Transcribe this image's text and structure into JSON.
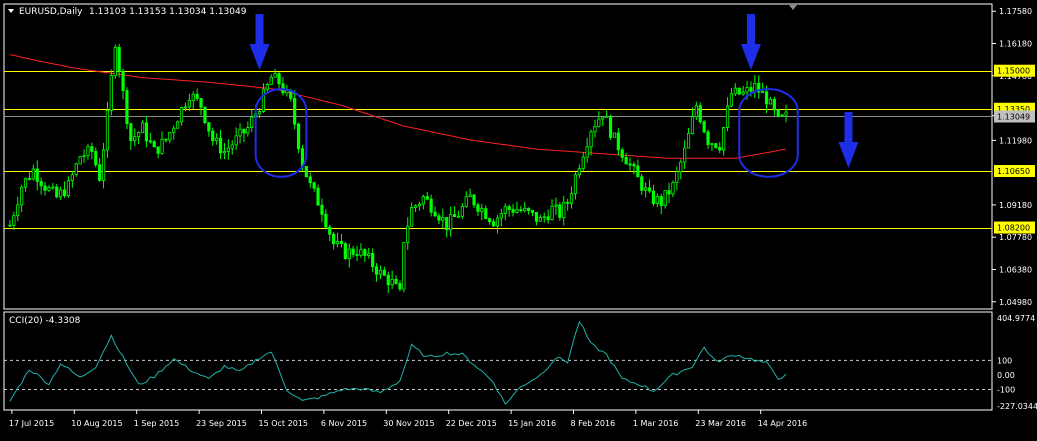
{
  "header": {
    "symbol_text": "EURUSD,Daily",
    "ohlc_text": "1.13103 1.13153 1.13034 1.13049"
  },
  "indicator": {
    "label": "CCI(20) -4.3308"
  },
  "colors": {
    "background": "#000000",
    "frame": "#ffffff",
    "bull_candle": "#00ff00",
    "bear_candle": "#00ff00",
    "moving_average": "#ff2020",
    "level_line": "#ffff00",
    "current_price_line": "#8c8c8c",
    "cci_line": "#20b2aa",
    "annotation": "#1e2ee8",
    "price_label_bg": "#ffff00",
    "current_label_bg": "#c0c0c0"
  },
  "chart_data": [
    {
      "type": "candlestick",
      "symbol": "EURUSD",
      "timeframe": "Daily",
      "x_tick_labels": [
        "17 Jul 2015",
        "10 Aug 2015",
        "1 Sep 2015",
        "23 Sep 2015",
        "15 Oct 2015",
        "6 Nov 2015",
        "30 Nov 2015",
        "22 Dec 2015",
        "15 Jan 2016",
        "8 Feb 2016",
        "1 Mar 2016",
        "23 Mar 2016",
        "14 Apr 2016"
      ],
      "y_tick_labels": [
        "1.17580",
        "1.16180",
        "1.14780",
        "1.13049",
        "1.11980",
        "1.09180",
        "1.07780",
        "1.06380",
        "1.04980"
      ],
      "ylim": [
        1.0484,
        1.1772
      ],
      "price_levels": [
        {
          "value": 1.15,
          "label": "1.15000"
        },
        {
          "value": 1.1335,
          "label": "1.13350"
        },
        {
          "value": 1.1065,
          "label": "1.10650"
        },
        {
          "value": 1.082,
          "label": "1.08200"
        }
      ],
      "current_price": {
        "value": 1.13049,
        "label": "1.13049"
      },
      "close_path": [
        [
          0,
          1.083
        ],
        [
          3,
          1.1
        ],
        [
          6,
          1.107
        ],
        [
          9,
          1.1
        ],
        [
          12,
          1.095
        ],
        [
          15,
          1.1
        ],
        [
          18,
          1.113
        ],
        [
          21,
          1.115
        ],
        [
          23,
          1.104
        ],
        [
          25,
          1.13
        ],
        [
          27,
          1.163
        ],
        [
          29,
          1.14
        ],
        [
          31,
          1.12
        ],
        [
          34,
          1.125
        ],
        [
          37,
          1.115
        ],
        [
          40,
          1.12
        ],
        [
          43,
          1.13
        ],
        [
          46,
          1.14
        ],
        [
          49,
          1.135
        ],
        [
          52,
          1.12
        ],
        [
          55,
          1.115
        ],
        [
          58,
          1.12
        ],
        [
          61,
          1.125
        ],
        [
          64,
          1.135
        ],
        [
          67,
          1.147
        ],
        [
          69,
          1.145
        ],
        [
          72,
          1.136
        ],
        [
          75,
          1.11
        ],
        [
          77,
          1.1
        ],
        [
          80,
          1.09
        ],
        [
          83,
          1.075
        ],
        [
          86,
          1.071
        ],
        [
          89,
          1.072
        ],
        [
          92,
          1.068
        ],
        [
          95,
          1.062
        ],
        [
          98,
          1.058
        ],
        [
          100,
          1.053
        ],
        [
          101,
          1.077
        ],
        [
          103,
          1.09
        ],
        [
          106,
          1.095
        ],
        [
          109,
          1.09
        ],
        [
          112,
          1.083
        ],
        [
          115,
          1.088
        ],
        [
          118,
          1.095
        ],
        [
          121,
          1.09
        ],
        [
          124,
          1.085
        ],
        [
          127,
          1.09
        ],
        [
          130,
          1.09
        ],
        [
          133,
          1.088
        ],
        [
          136,
          1.085
        ],
        [
          139,
          1.09
        ],
        [
          141,
          1.088
        ],
        [
          143,
          1.093
        ],
        [
          146,
          1.11
        ],
        [
          149,
          1.125
        ],
        [
          152,
          1.132
        ],
        [
          155,
          1.12
        ],
        [
          158,
          1.112
        ],
        [
          161,
          1.103
        ],
        [
          164,
          1.095
        ],
        [
          167,
          1.093
        ],
        [
          170,
          1.1
        ],
        [
          173,
          1.115
        ],
        [
          176,
          1.135
        ],
        [
          179,
          1.12
        ],
        [
          182,
          1.118
        ],
        [
          185,
          1.14
        ],
        [
          188,
          1.14
        ],
        [
          191,
          1.143
        ],
        [
          194,
          1.138
        ],
        [
          197,
          1.128
        ],
        [
          199,
          1.13
        ]
      ],
      "moving_average_path": [
        [
          0,
          1.157
        ],
        [
          8,
          1.154
        ],
        [
          17,
          1.151
        ],
        [
          34,
          1.147
        ],
        [
          51,
          1.145
        ],
        [
          68,
          1.142
        ],
        [
          85,
          1.135
        ],
        [
          101,
          1.126
        ],
        [
          118,
          1.12
        ],
        [
          135,
          1.116
        ],
        [
          152,
          1.114
        ],
        [
          169,
          1.112
        ],
        [
          186,
          1.112
        ],
        [
          199,
          1.116
        ]
      ],
      "annotations": [
        {
          "type": "arrow-down",
          "bar": 64
        },
        {
          "type": "arrow-down",
          "bar": 190
        },
        {
          "type": "arrow-down",
          "bar": 215
        },
        {
          "type": "ellipse",
          "bar_from": 63,
          "bar_to": 76,
          "price_from": 1.104,
          "price_to": 1.142
        },
        {
          "type": "ellipse",
          "bar_from": 187,
          "bar_to": 202,
          "price_from": 1.104,
          "price_to": 1.142
        }
      ]
    },
    {
      "type": "line",
      "name": "CCI(20)",
      "last_value": -4.3308,
      "y_tick_labels": [
        "404.9774",
        "100",
        "0.00",
        "-100",
        "-227.0344"
      ],
      "ylim": [
        -227.0344,
        404.9774
      ],
      "dashed_levels": [
        100,
        -100
      ],
      "path": [
        [
          0,
          -180
        ],
        [
          5,
          40
        ],
        [
          10,
          -60
        ],
        [
          13,
          80
        ],
        [
          18,
          -20
        ],
        [
          22,
          60
        ],
        [
          26,
          270
        ],
        [
          29,
          120
        ],
        [
          33,
          -70
        ],
        [
          37,
          -10
        ],
        [
          42,
          110
        ],
        [
          46,
          40
        ],
        [
          51,
          -30
        ],
        [
          55,
          60
        ],
        [
          59,
          20
        ],
        [
          64,
          120
        ],
        [
          67,
          160
        ],
        [
          71,
          -100
        ],
        [
          75,
          -180
        ],
        [
          80,
          -150
        ],
        [
          85,
          -100
        ],
        [
          90,
          -95
        ],
        [
          95,
          -120
        ],
        [
          100,
          -40
        ],
        [
          103,
          200
        ],
        [
          107,
          120
        ],
        [
          112,
          150
        ],
        [
          116,
          140
        ],
        [
          120,
          50
        ],
        [
          124,
          -50
        ],
        [
          127,
          -200
        ],
        [
          131,
          -80
        ],
        [
          136,
          0
        ],
        [
          140,
          120
        ],
        [
          143,
          90
        ],
        [
          146,
          370
        ],
        [
          149,
          210
        ],
        [
          153,
          140
        ],
        [
          157,
          -30
        ],
        [
          162,
          -70
        ],
        [
          165,
          -110
        ],
        [
          170,
          0
        ],
        [
          175,
          60
        ],
        [
          178,
          190
        ],
        [
          181,
          90
        ],
        [
          186,
          140
        ],
        [
          190,
          110
        ],
        [
          194,
          80
        ],
        [
          197,
          -20
        ],
        [
          199,
          -4.33
        ]
      ]
    }
  ]
}
